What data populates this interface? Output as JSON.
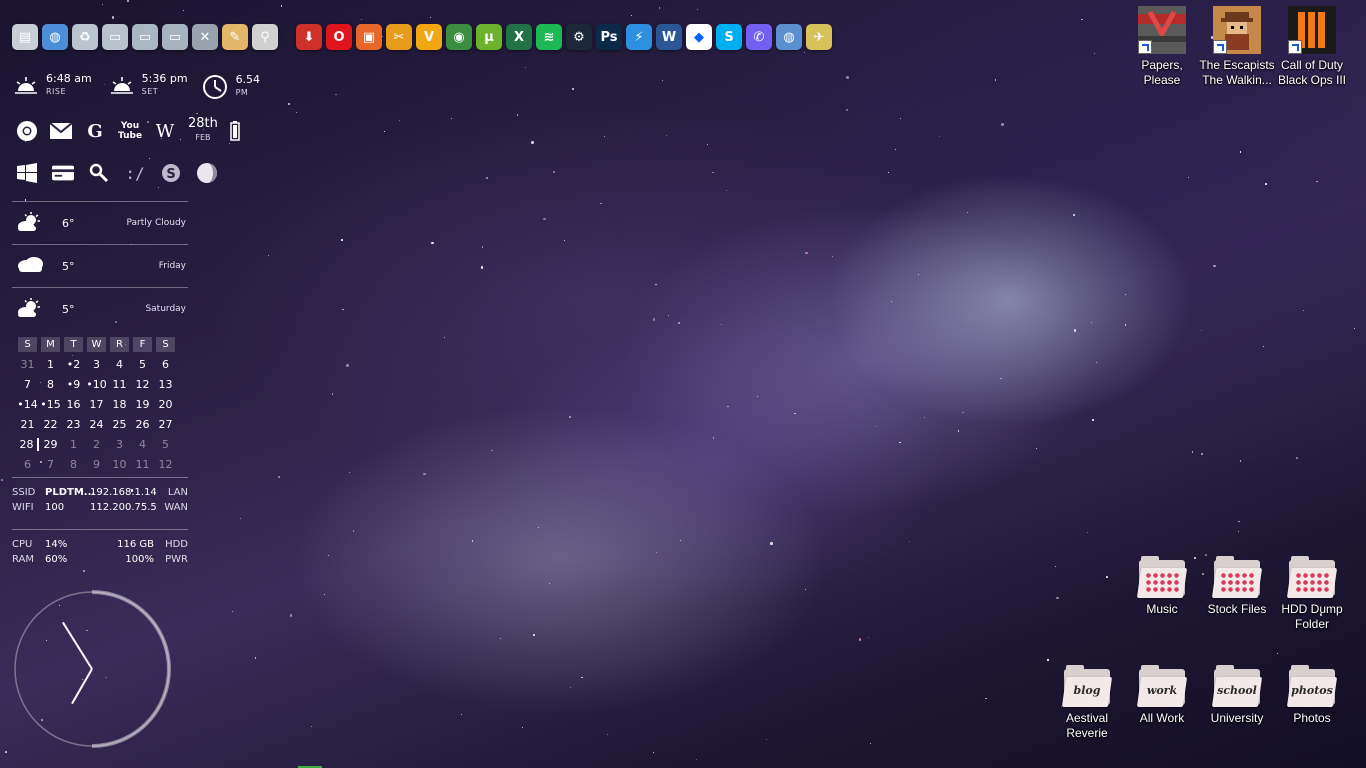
{
  "dock_left": [
    {
      "name": "computer-icon",
      "glyph": "▤",
      "color": "#c9ced6"
    },
    {
      "name": "network-globe-icon",
      "glyph": "◍",
      "color": "#4d8ed8"
    },
    {
      "name": "recycle-bin-icon",
      "glyph": "♻",
      "color": "#b9c4cf"
    },
    {
      "name": "folder-icon",
      "glyph": "▭",
      "color": "#b8c2cc"
    },
    {
      "name": "documents-folder-icon",
      "glyph": "▭",
      "color": "#aab6c2"
    },
    {
      "name": "pictures-folder-icon",
      "glyph": "▭",
      "color": "#a6b2be"
    },
    {
      "name": "tools-icon",
      "glyph": "✕",
      "color": "#9aa3ad"
    },
    {
      "name": "paint-palette-icon",
      "glyph": "✎",
      "color": "#e3b76a"
    },
    {
      "name": "magnifier-icon",
      "glyph": "⚲",
      "color": "#d0d0d0"
    }
  ],
  "dock_right": [
    {
      "name": "downloader-icon",
      "glyph": "⬇",
      "color": "#d0302a"
    },
    {
      "name": "opera-icon",
      "glyph": "O",
      "color": "#e0151c"
    },
    {
      "name": "presentation-app-icon",
      "glyph": "▣",
      "color": "#e7672a"
    },
    {
      "name": "video-editor-icon",
      "glyph": "✂",
      "color": "#e69b1b"
    },
    {
      "name": "vlc-v-icon",
      "glyph": "V",
      "color": "#f1a712"
    },
    {
      "name": "chrome-icon",
      "glyph": "◉",
      "color": "#3b8e3f"
    },
    {
      "name": "utorrent-icon",
      "glyph": "µ",
      "color": "#6cb32b"
    },
    {
      "name": "excel-icon",
      "glyph": "X",
      "color": "#217346"
    },
    {
      "name": "spotify-icon",
      "glyph": "≋",
      "color": "#1db954"
    },
    {
      "name": "steam-icon",
      "glyph": "⚙",
      "color": "#1b2838"
    },
    {
      "name": "photoshop-icon",
      "glyph": "Ps",
      "color": "#0b2a4a"
    },
    {
      "name": "lightning-app-icon",
      "glyph": "⚡",
      "color": "#2d8fe0"
    },
    {
      "name": "word-icon",
      "glyph": "W",
      "color": "#2b5797"
    },
    {
      "name": "dropbox-icon",
      "glyph": "◆",
      "color": "#ffffff"
    },
    {
      "name": "skype-icon",
      "glyph": "S",
      "color": "#00aff0"
    },
    {
      "name": "viber-icon",
      "glyph": "✆",
      "color": "#7360f2"
    },
    {
      "name": "world-browser-icon",
      "glyph": "◍",
      "color": "#5a8fd0"
    },
    {
      "name": "airplane-icon",
      "glyph": "✈",
      "color": "#d7c25a"
    }
  ],
  "sun": {
    "rise_time": "6:48 am",
    "rise_label": "RISE",
    "set_time": "5:36 pm",
    "set_label": "SET",
    "clock_time": "6.54",
    "clock_label": "PM"
  },
  "quick_row1": {
    "google_glyph": "G",
    "youtube_glyph": "You Tube",
    "wiki_glyph": "W",
    "day": "28th",
    "month": "FEB"
  },
  "weather": [
    {
      "temp": "6°",
      "desc": "Partly Cloudy",
      "icon": "partly-cloudy-icon"
    },
    {
      "temp": "5°",
      "desc": "Friday",
      "icon": "cloudy-icon"
    },
    {
      "temp": "5°",
      "desc": "Saturday",
      "icon": "partly-cloudy-icon"
    }
  ],
  "calendar": {
    "headers": [
      "S",
      "M",
      "T",
      "W",
      "R",
      "F",
      "S"
    ],
    "weeks": [
      [
        {
          "d": "31",
          "dim": true
        },
        {
          "d": "1"
        },
        {
          "d": "•2"
        },
        {
          "d": "3"
        },
        {
          "d": "4"
        },
        {
          "d": "5"
        },
        {
          "d": "6"
        }
      ],
      [
        {
          "d": "7"
        },
        {
          "d": "8"
        },
        {
          "d": "•9"
        },
        {
          "d": "•10"
        },
        {
          "d": "11"
        },
        {
          "d": "12"
        },
        {
          "d": "13"
        }
      ],
      [
        {
          "d": "•14"
        },
        {
          "d": "•15"
        },
        {
          "d": "16"
        },
        {
          "d": "17"
        },
        {
          "d": "18"
        },
        {
          "d": "19"
        },
        {
          "d": "20"
        }
      ],
      [
        {
          "d": "21"
        },
        {
          "d": "22"
        },
        {
          "d": "23"
        },
        {
          "d": "24"
        },
        {
          "d": "25"
        },
        {
          "d": "26"
        },
        {
          "d": "27"
        }
      ],
      [
        {
          "d": "28",
          "today": true
        },
        {
          "d": "29"
        },
        {
          "d": "1",
          "dim": true
        },
        {
          "d": "2",
          "dim": true
        },
        {
          "d": "3",
          "dim": true
        },
        {
          "d": "4",
          "dim": true
        },
        {
          "d": "5",
          "dim": true
        }
      ],
      [
        {
          "d": "6",
          "dim": true
        },
        {
          "d": "7",
          "dim": true
        },
        {
          "d": "8",
          "dim": true
        },
        {
          "d": "9",
          "dim": true
        },
        {
          "d": "10",
          "dim": true
        },
        {
          "d": "11",
          "dim": true
        },
        {
          "d": "12",
          "dim": true
        }
      ]
    ]
  },
  "network": {
    "ssid_label": "SSID",
    "ssid_value": "PLDTM...",
    "ip_local": "192.168.1.14",
    "lan_label": "LAN",
    "wifi_label": "WIFI",
    "wifi_value": "100",
    "ip_wan": "112.200.75.5",
    "wan_label": "WAN"
  },
  "system": {
    "cpu_label": "CPU",
    "cpu_value": "14%",
    "hdd_value": "116 GB",
    "hdd_label": "HDD",
    "ram_label": "RAM",
    "ram_value": "60%",
    "pwr_value": "100%",
    "pwr_label": "PWR"
  },
  "analog_clock": {
    "hour_angle_deg": -32,
    "minute_angle_deg": 210,
    "seconds_progress": 0.5
  },
  "desktop_top": [
    {
      "line1": "Papers,",
      "line2": "Please",
      "icon": "papers-please-icon"
    },
    {
      "line1": "The Escapists",
      "line2": "The Walkin...",
      "icon": "escapists-icon"
    },
    {
      "line1": "Call of Duty",
      "line2": "Black Ops III",
      "icon": "black-ops-icon"
    }
  ],
  "folders_row1": [
    {
      "line1": "Music",
      "line2": ""
    },
    {
      "line1": "Stock Files",
      "line2": ""
    },
    {
      "line1": "HDD Dump",
      "line2": "Folder"
    }
  ],
  "folders_row2": [
    {
      "line1": "Aestival",
      "line2": "Reverie",
      "word": "blog"
    },
    {
      "line1": "All Work",
      "line2": "",
      "word": "work"
    },
    {
      "line1": "University",
      "line2": "",
      "word": "school"
    },
    {
      "line1": "Photos",
      "line2": "",
      "word": "photos"
    }
  ]
}
